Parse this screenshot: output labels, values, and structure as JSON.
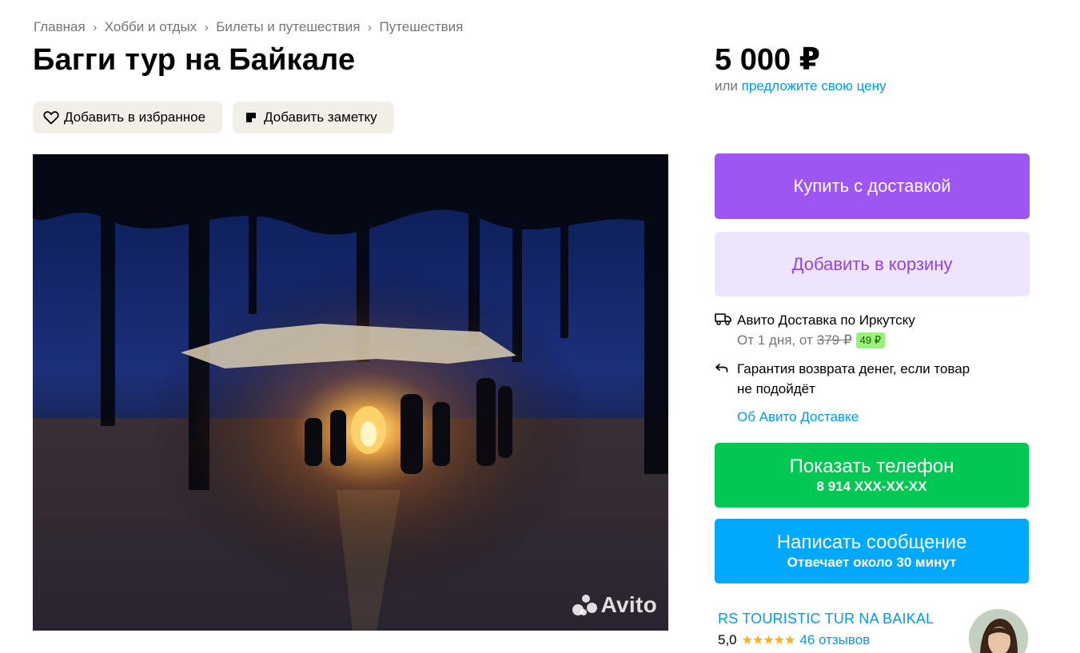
{
  "breadcrumb": [
    "Главная",
    "Хобби и отдых",
    "Билеты и путешествия",
    "Путешествия"
  ],
  "breadcrumb_separator": "›",
  "title": "Багги тур на Байкале",
  "actions": {
    "favorite_label": "Добавить в избранное",
    "note_label": "Добавить заметку"
  },
  "price": {
    "value": "5 000 ₽",
    "or_text": "или ",
    "offer_link": "предложите свою цену"
  },
  "buttons": {
    "buy": "Купить с доставкой",
    "cart": "Добавить в корзину",
    "phone_title": "Показать телефон",
    "phone_number": "8 914 XXX-XX-XX",
    "message_title": "Написать сообщение",
    "message_subtitle": "Отвечает около 30 минут"
  },
  "delivery": {
    "title": "Авито Доставка по Иркутску",
    "terms": "От 1 дня, от",
    "old_price": "379 ₽",
    "new_price": "49 ₽",
    "guarantee_line1": "Гарантия возврата денег, если товар",
    "guarantee_line2": "не подойдёт",
    "about_link": "Об Авито Доставке"
  },
  "photo": {
    "watermark": "Avito"
  },
  "seller": {
    "name": "RS TOURISTIC TUR NA BAIKAL",
    "rating": "5,0",
    "stars": "★★★★★",
    "reviews": "46 отзывов"
  },
  "colors": {
    "buy": "#9e55f1",
    "cart_bg": "#efe4fd",
    "phone": "#00c853",
    "message": "#00a9fe",
    "link": "#0099f7",
    "star": "#ffb021"
  }
}
